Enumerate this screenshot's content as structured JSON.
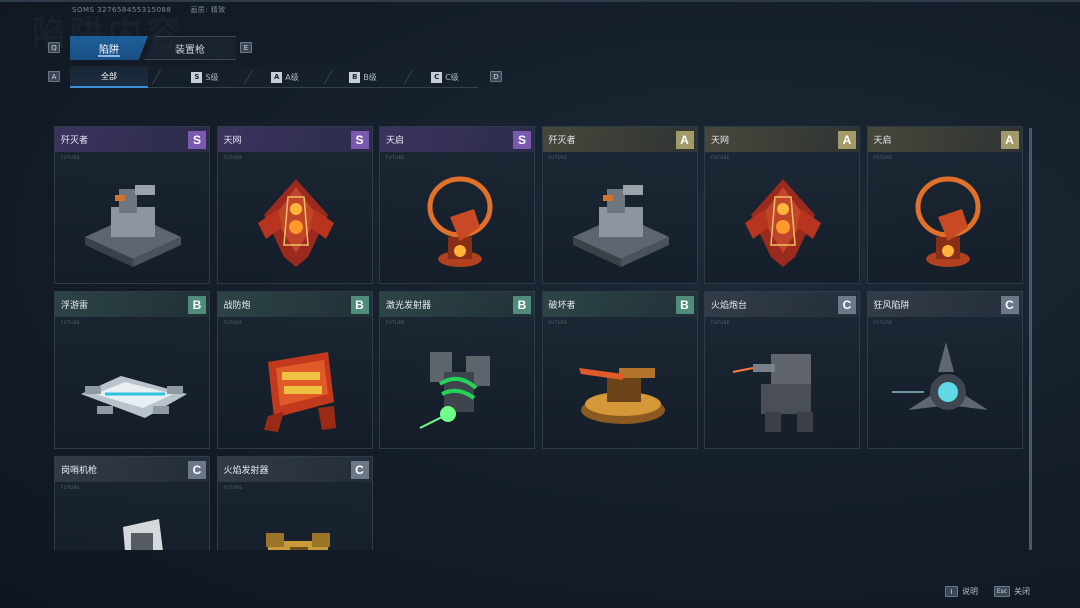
{
  "header": {
    "watermark": "陷阱内容",
    "id_line": [
      "SOMS 327658455315088",
      "画质: 精致"
    ]
  },
  "tabs": {
    "prev_key": "Q",
    "next_key": "E",
    "items": [
      {
        "label": "陷阱",
        "active": true
      },
      {
        "label": "装置枪",
        "active": false
      }
    ]
  },
  "filters": {
    "prev_key": "A",
    "next_key": "D",
    "items": [
      {
        "label": "全部",
        "badge": "",
        "active": true
      },
      {
        "label": "S级",
        "badge": "S",
        "active": false
      },
      {
        "label": "A级",
        "badge": "A",
        "active": false
      },
      {
        "label": "B级",
        "badge": "B",
        "active": false
      },
      {
        "label": "C级",
        "badge": "C",
        "active": false
      }
    ]
  },
  "card_subtitle": "FUTURE",
  "cards": [
    {
      "name": "歼灭者",
      "rank": "S",
      "icon": "turret-annihilator-icon"
    },
    {
      "name": "天网",
      "rank": "S",
      "icon": "skynet-icon"
    },
    {
      "name": "天启",
      "rank": "S",
      "icon": "apocalypse-icon"
    },
    {
      "name": "歼灭者",
      "rank": "A",
      "icon": "turret-annihilator-icon"
    },
    {
      "name": "天网",
      "rank": "A",
      "icon": "skynet-icon"
    },
    {
      "name": "天启",
      "rank": "A",
      "icon": "apocalypse-icon"
    },
    {
      "name": "浮游雷",
      "rank": "B",
      "icon": "floating-mine-icon"
    },
    {
      "name": "战防炮",
      "rank": "B",
      "icon": "anti-tank-cannon-icon"
    },
    {
      "name": "激光发射器",
      "rank": "B",
      "icon": "laser-emitter-icon"
    },
    {
      "name": "破坏者",
      "rank": "B",
      "icon": "destroyer-icon"
    },
    {
      "name": "火焰炮台",
      "rank": "C",
      "icon": "flame-turret-icon"
    },
    {
      "name": "狂风陷阱",
      "rank": "C",
      "icon": "gale-trap-icon"
    },
    {
      "name": "岗哨机枪",
      "rank": "C",
      "icon": "sentry-gun-icon"
    },
    {
      "name": "火焰发射器",
      "rank": "C",
      "icon": "flamethrower-icon"
    }
  ],
  "footer": {
    "help_key": "I",
    "help_label": "说明",
    "close_key": "Esc",
    "close_label": "关闭"
  },
  "colors": {
    "rank_S": "#7a5ab0",
    "rank_A": "#a39a6a",
    "rank_B": "#4f8c7c",
    "rank_C": "#6c7888",
    "tab_active": "#1e5f9a"
  }
}
